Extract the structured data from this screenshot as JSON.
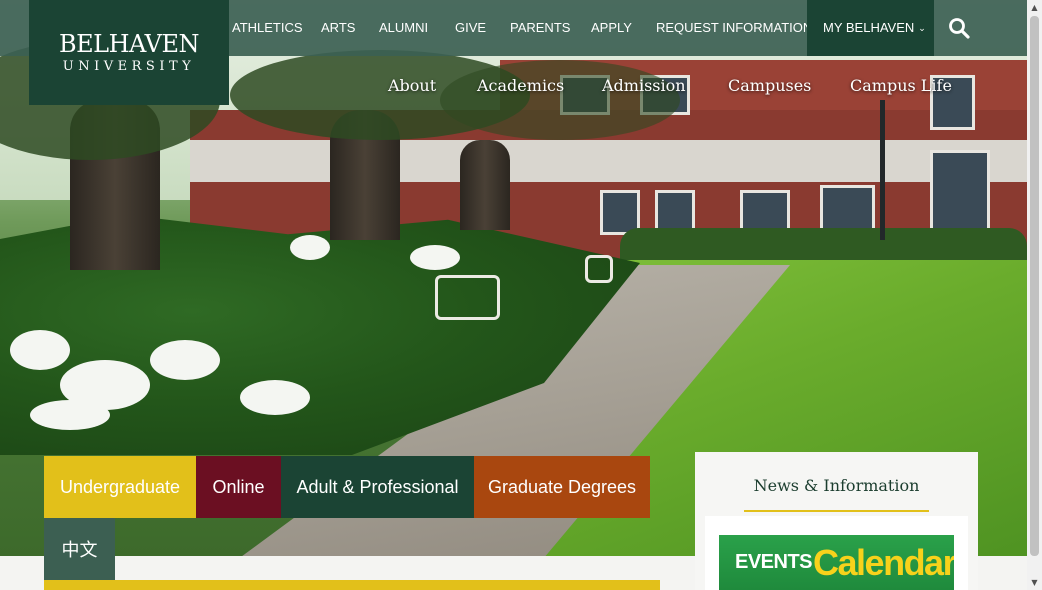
{
  "logo": {
    "line1": "BELHAVEN",
    "line2": "UNIVERSITY"
  },
  "utility_nav": [
    {
      "label": "ATHLETICS"
    },
    {
      "label": "ARTS"
    },
    {
      "label": "ALUMNI"
    },
    {
      "label": "GIVE"
    },
    {
      "label": "PARENTS"
    },
    {
      "label": "APPLY"
    },
    {
      "label": "REQUEST INFORMATION"
    }
  ],
  "my_belhaven": {
    "label": "MY BELHAVEN",
    "icon": "chevron-down-icon"
  },
  "search": {
    "icon": "search-icon"
  },
  "main_nav": [
    {
      "label": "About"
    },
    {
      "label": "Academics"
    },
    {
      "label": "Admission"
    },
    {
      "label": "Campuses"
    },
    {
      "label": "Campus Life"
    }
  ],
  "program_tabs": [
    {
      "label": "Undergraduate",
      "color": "#e2c01a"
    },
    {
      "label": "Online",
      "color": "#6b0f22"
    },
    {
      "label": "Adult & Professional",
      "color": "#1b4434"
    },
    {
      "label": "Graduate Degrees",
      "color": "#a9470f"
    },
    {
      "label": "中文",
      "color": "#3c5f52"
    }
  ],
  "news": {
    "title": "News & Information",
    "events_banner": {
      "part1": "EVENTS",
      "part2": "Calendar"
    }
  },
  "colors": {
    "brand_green": "#1b4434",
    "topbar": "#3c6052",
    "gold": "#e2c01a",
    "maroon": "#6b0f22",
    "rust": "#a9470f"
  }
}
